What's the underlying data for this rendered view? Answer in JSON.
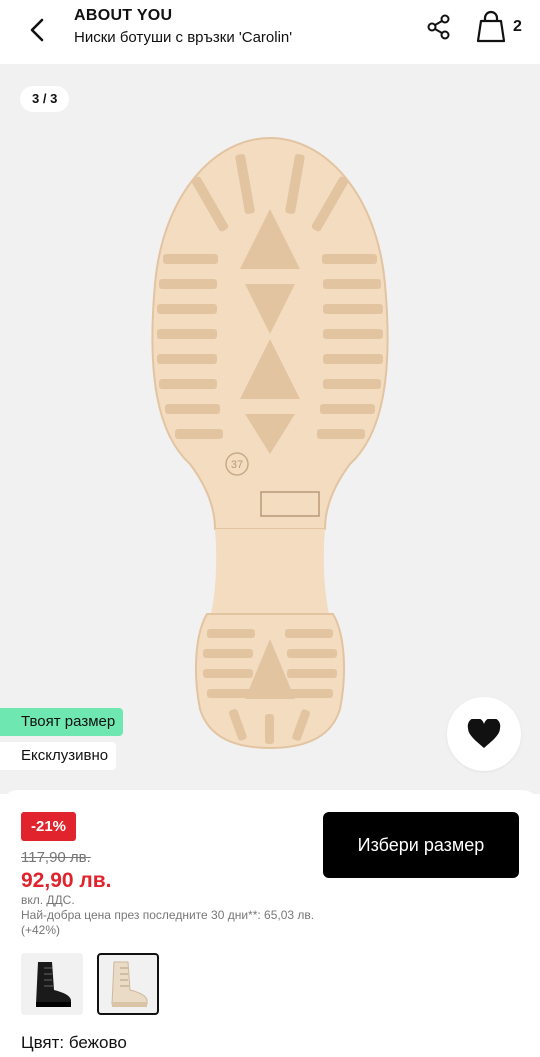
{
  "header": {
    "brand": "ABOUT YOU",
    "product_title": "Ниски ботуши с връзки 'Carolin'",
    "bag_count": "2"
  },
  "gallery": {
    "counter": "3 / 3",
    "sole_size_marking": "37",
    "badges": {
      "your_size": "Твоят размер",
      "exclusive": "Ексклузивно"
    }
  },
  "purchase": {
    "discount": "-21%",
    "old_price": "117,90 лв.",
    "new_price": "92,90 лв.",
    "vat_note": "вкл. ДДС.",
    "best_price_note": "Най-добра цена през последните 30 дни**: 65,03 лв. (+42%)",
    "cta_label": "Избери размер",
    "color_label": "Цвят: бежово",
    "variants": [
      {
        "name": "black",
        "selected": false
      },
      {
        "name": "beige",
        "selected": true
      }
    ]
  },
  "colors": {
    "sole": "#f3dcc0",
    "sole_shadow": "#e2c4a1",
    "gallery_bg": "#f1f1f1",
    "discount_red": "#e0232c",
    "size_tag_green": "#6ee7b0"
  }
}
